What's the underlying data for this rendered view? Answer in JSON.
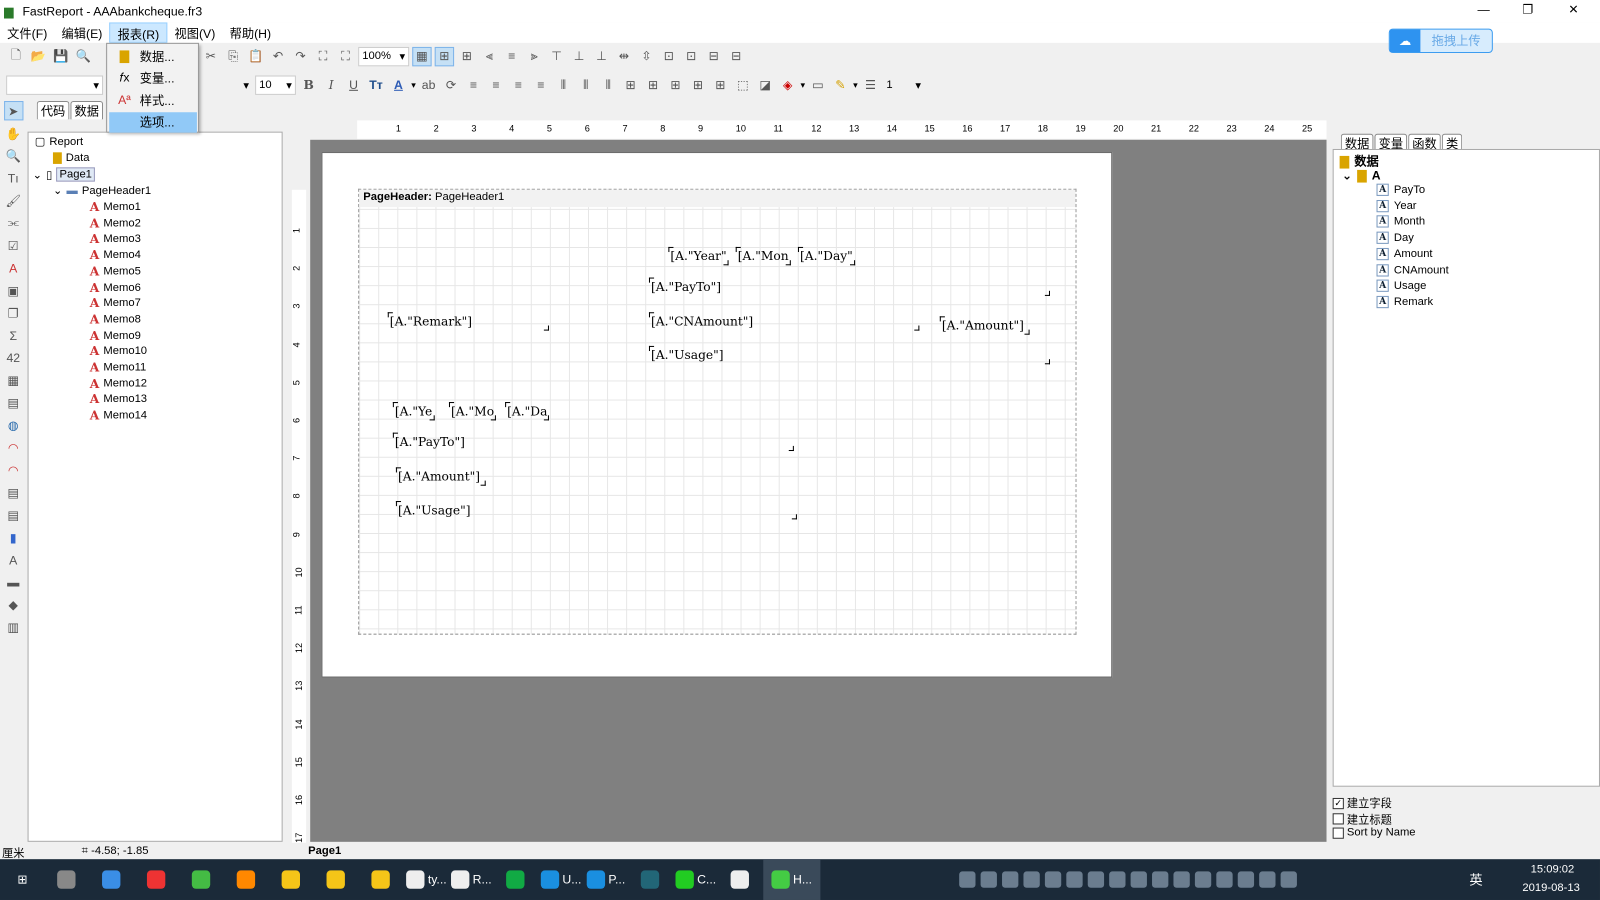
{
  "window": {
    "title": "FastReport - AAAbankcheque.fr3",
    "minimize": "—",
    "restore": "❐",
    "close": "✕"
  },
  "menubar": [
    "文件(F)",
    "编辑(E)",
    "报表(R)",
    "视图(V)",
    "帮助(H)"
  ],
  "upload_button": "拖拽上传",
  "toolbar": {
    "zoom": "100%",
    "font_size": "10",
    "line_width": "1",
    "bold": "B",
    "italic": "I",
    "underline": "U"
  },
  "left_tabs": [
    "代码",
    "数据"
  ],
  "report_menu": [
    {
      "icon": "database-icon",
      "label": "数据..."
    },
    {
      "icon": "function-icon",
      "label": "变量..."
    },
    {
      "icon": "style-icon",
      "label": "样式..."
    },
    {
      "icon": "",
      "label": "选项..."
    }
  ],
  "tree": {
    "root": "Report",
    "data": "Data",
    "page": "Page1",
    "band": "PageHeader1",
    "memos": [
      "Memo1",
      "Memo2",
      "Memo3",
      "Memo4",
      "Memo5",
      "Memo6",
      "Memo7",
      "Memo8",
      "Memo9",
      "Memo10",
      "Memo11",
      "Memo12",
      "Memo13",
      "Memo14"
    ]
  },
  "ruler_h": [
    "1",
    "2",
    "3",
    "4",
    "5",
    "6",
    "7",
    "8",
    "9",
    "10",
    "11",
    "12",
    "13",
    "14",
    "15",
    "16",
    "17",
    "18",
    "19",
    "20",
    "21",
    "22",
    "23",
    "24",
    "25"
  ],
  "ruler_v": [
    "1",
    "2",
    "3",
    "4",
    "5",
    "6",
    "7",
    "8",
    "9",
    "10",
    "11",
    "12",
    "13",
    "14",
    "15",
    "16",
    "17"
  ],
  "band": {
    "type": "PageHeader:",
    "name": "PageHeader1"
  },
  "memos": [
    "[A.\"Year\"",
    "[A.\"Mon",
    "[A.\"Day\"",
    "[A.\"PayTo\"]",
    "[A.\"Remark\"]",
    "[A.\"CNAmount\"]",
    "[A.\"Amount\"]",
    "[A.\"Usage\"]",
    "[A.\"Ye",
    "[A.\"Mo",
    "[A.\"Da",
    "[A.\"PayTo\"]",
    "[A.\"Amount\"]",
    "[A.\"Usage\"]"
  ],
  "right_tabs": [
    "数据",
    "变量",
    "函数",
    "类"
  ],
  "data_tree": {
    "root": "数据",
    "source": "A",
    "fields": [
      "PayTo",
      "Year",
      "Month",
      "Day",
      "Amount",
      "CNAmount",
      "Usage",
      "Remark"
    ]
  },
  "options": [
    {
      "label": "建立字段",
      "checked": true
    },
    {
      "label": "建立标题",
      "checked": false
    },
    {
      "label": "Sort by Name",
      "checked": false
    }
  ],
  "status": {
    "unit": "厘米",
    "coords": "-4.58; -1.85",
    "page": "Page1"
  },
  "taskbar": {
    "items": [
      "",
      "",
      "",
      "",
      "",
      "",
      "",
      "",
      "ty...",
      "R...",
      "",
      "U...",
      "P...",
      "",
      "C...",
      "",
      "H...",
      ""
    ],
    "time": "15:09:02",
    "date": "2019-08-13",
    "ime": "英"
  }
}
